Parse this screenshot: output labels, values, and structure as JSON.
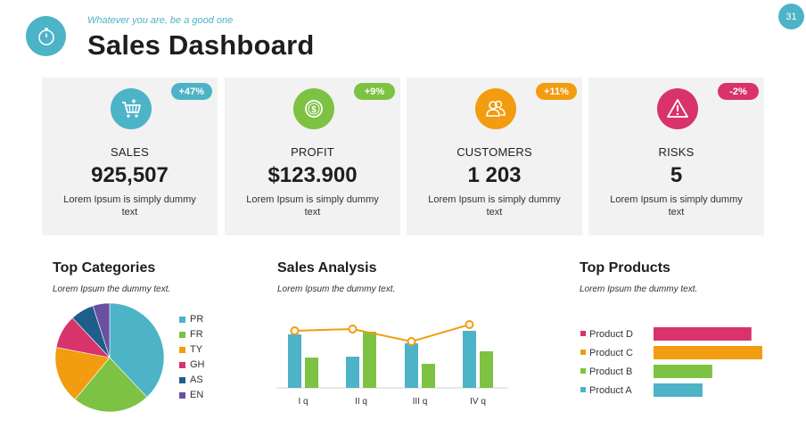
{
  "header": {
    "tagline": "Whatever you are, be a good one",
    "title": "Sales Dashboard",
    "page_number": "31",
    "logo_icon": "stopwatch-icon"
  },
  "colors": {
    "teal": "#4db3c7",
    "green": "#7dc242",
    "orange": "#f29c0f",
    "pink": "#d8336b",
    "navy": "#1f5e8a",
    "purple": "#6a4fa3"
  },
  "cards": [
    {
      "label": "SALES",
      "value": "925,507",
      "badge": "+47%",
      "desc": "Lorem Ipsum is simply dummy text",
      "icon": "shopping-cart-icon",
      "color": "#4db3c7"
    },
    {
      "label": "PROFIT",
      "value": "$123.900",
      "badge": "+9%",
      "desc": "Lorem Ipsum is simply dummy text",
      "icon": "dollar-coin-icon",
      "color": "#7dc242"
    },
    {
      "label": "CUSTOMERS",
      "value": "1 203",
      "badge": "+11%",
      "desc": "Lorem Ipsum is simply dummy text",
      "icon": "users-icon",
      "color": "#f29c0f"
    },
    {
      "label": "RISKS",
      "value": "5",
      "badge": "-2%",
      "desc": "Lorem Ipsum is simply dummy text",
      "icon": "warning-icon",
      "color": "#d8336b"
    }
  ],
  "sections": {
    "categories": {
      "title": "Top Categories",
      "subtitle": "Lorem Ipsum the dummy  text."
    },
    "analysis": {
      "title": "Sales Analysis",
      "subtitle": "Lorem Ipsum the dummy  text."
    },
    "products": {
      "title": "Top Products",
      "subtitle": "Lorem Ipsum the dummy  text."
    }
  },
  "chart_data": [
    {
      "type": "pie",
      "title": "Top Categories",
      "categories": [
        "PR",
        "FR",
        "TY",
        "GH",
        "AS",
        "EN"
      ],
      "values": [
        38,
        23,
        17,
        10,
        7,
        5
      ],
      "colors": [
        "#4db3c7",
        "#7dc242",
        "#f29c0f",
        "#d8336b",
        "#1f5e8a",
        "#6a4fa3"
      ],
      "legend": "right"
    },
    {
      "type": "bar",
      "title": "Sales Analysis",
      "categories": [
        "I q",
        "II q",
        "III q",
        "IV q"
      ],
      "series": [
        {
          "values": [
            60,
            35,
            50,
            64
          ],
          "color": "#4db3c7"
        },
        {
          "values": [
            34,
            63,
            27,
            41
          ],
          "color": "#7dc242"
        }
      ],
      "line": {
        "values": [
          64,
          66,
          52,
          71
        ],
        "color": "#f29c0f"
      },
      "ylim": [
        0,
        80
      ],
      "grid": false
    },
    {
      "type": "bar",
      "orientation": "horizontal",
      "title": "Top Products",
      "categories": [
        "Product D",
        "Product C",
        "Product B",
        "Product A"
      ],
      "values": [
        90,
        100,
        54,
        45
      ],
      "colors": [
        "#d8336b",
        "#f29c0f",
        "#7dc242",
        "#4db3c7"
      ],
      "xlim": [
        0,
        100
      ]
    }
  ]
}
